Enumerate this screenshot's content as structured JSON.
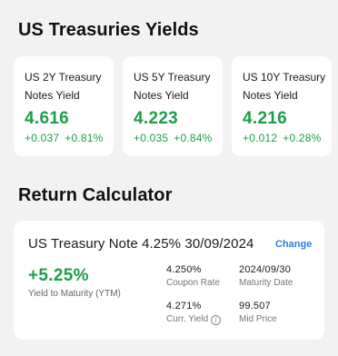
{
  "yields_section": {
    "title": "US Treasuries Yields",
    "cards": [
      {
        "name": "US 2Y Treasury Notes Yield",
        "value": "4.616",
        "change": "+0.037",
        "change_pct": "+0.81%"
      },
      {
        "name": "US 5Y Treasury Notes Yield",
        "value": "4.223",
        "change": "+0.035",
        "change_pct": "+0.84%"
      },
      {
        "name": "US 10Y Treasury Notes Yield",
        "value": "4.216",
        "change": "+0.012",
        "change_pct": "+0.28%"
      }
    ]
  },
  "calculator": {
    "title": "Return Calculator",
    "note_title": "US Treasury Note 4.25% 30/09/2024",
    "change_label": "Change",
    "ytm_value": "+5.25%",
    "ytm_label": "Yield to Maturity (YTM)",
    "coupon_value": "4.250%",
    "coupon_label": "Coupon Rate",
    "maturity_value": "2024/09/30",
    "maturity_label": "Maturity Date",
    "curr_yield_value": "4.271%",
    "curr_yield_label": "Curr. Yield",
    "mid_price_value": "99.507",
    "mid_price_label": "Mid Price",
    "info_icon": "i"
  },
  "colors": {
    "positive": "#1e9e4a",
    "link": "#2f7de1",
    "background": "#f2f2f2",
    "card": "#ffffff"
  },
  "icons": {
    "info": "info-icon"
  }
}
